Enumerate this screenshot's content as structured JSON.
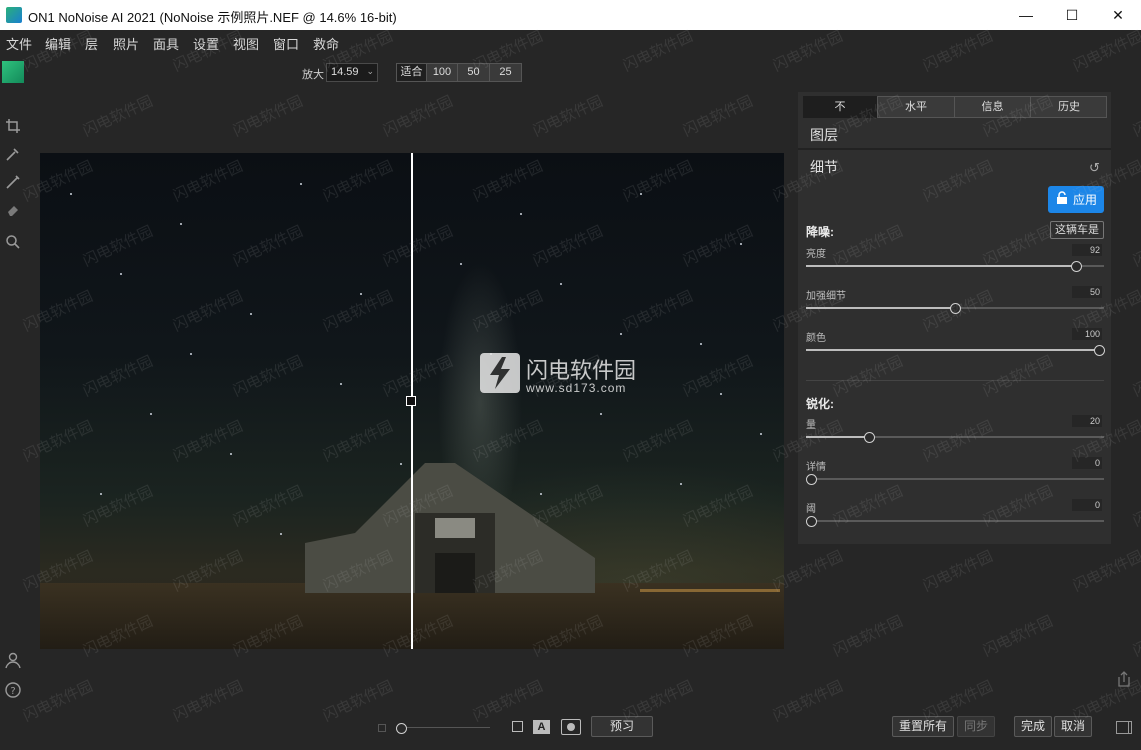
{
  "window": {
    "title": "ON1 NoNoise AI 2021 (NoNoise 示例照片.NEF @ 14.6% 16-bit)",
    "minimize": "—",
    "maximize": "☐",
    "close": "✕"
  },
  "menu": [
    "文件",
    "编辑",
    "层",
    "照片",
    "面具",
    "设置",
    "视图",
    "窗口",
    "救命"
  ],
  "zoom": {
    "label": "放大",
    "value": "14.59",
    "presets": [
      "适合",
      "100",
      "50",
      "25"
    ]
  },
  "watermark": {
    "logo_text": "闪电软件园",
    "url": "www.sd173.com",
    "tile_text": "闪电软件园"
  },
  "panel": {
    "tabs": [
      "不",
      "水平",
      "信息",
      "历史"
    ],
    "active_tab": 0,
    "layers_title": "图层",
    "detail_title": "细节",
    "apply_label": "应用",
    "preset_label": "这辆车是",
    "noise_group": "降噪:",
    "noise_sliders": [
      {
        "label": "亮度",
        "value": 92
      },
      {
        "label": "加强细节",
        "value": 50
      },
      {
        "label": "颜色",
        "value": 100
      }
    ],
    "sharpen_group": "锐化:",
    "sharpen_sliders": [
      {
        "label": "量",
        "value": 20
      },
      {
        "label": "详情",
        "value": 0
      },
      {
        "label": "阈",
        "value": 0
      }
    ]
  },
  "bottom": {
    "preview_label": "预习",
    "reset_all": "重置所有",
    "sync": "同步",
    "done": "完成",
    "cancel": "取消"
  },
  "colors": {
    "accent": "#1c86e8",
    "background": "#262626",
    "panel": "#2f2f2f"
  }
}
